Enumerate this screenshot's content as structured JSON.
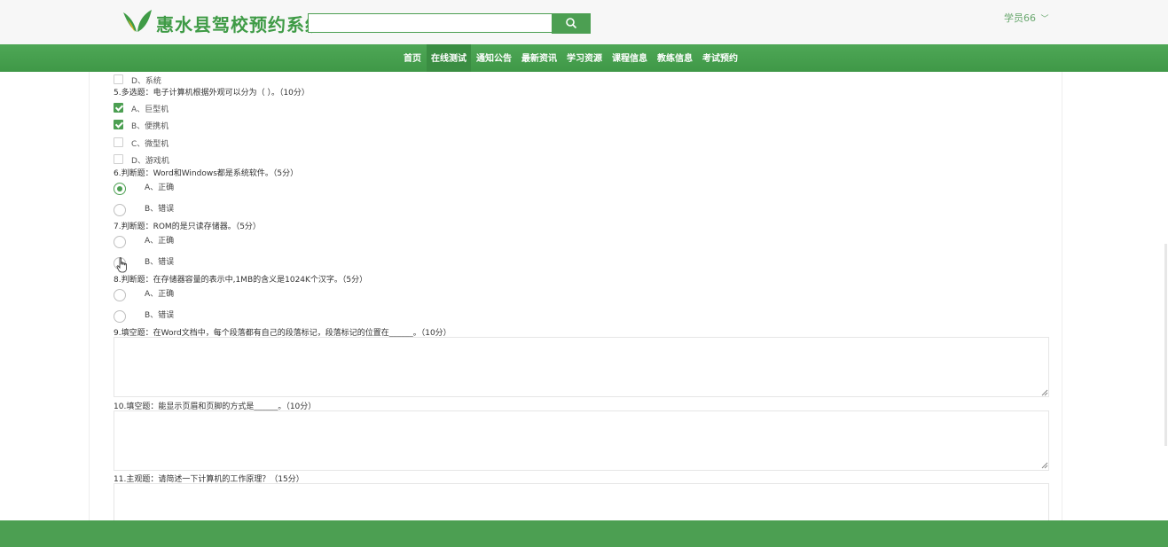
{
  "header": {
    "title": "惠水县驾校预约系统",
    "search_placeholder": "",
    "search_icon": "search-icon",
    "user_label": "学员66",
    "user_chevron": "﹀",
    "brand_color": "#3f9b46"
  },
  "nav": {
    "items": [
      {
        "label": "首页"
      },
      {
        "label": "在线测试"
      },
      {
        "label": "通知公告"
      },
      {
        "label": "最新资讯"
      },
      {
        "label": "学习资源"
      },
      {
        "label": "课程信息"
      },
      {
        "label": "教练信息"
      },
      {
        "label": "考试预约"
      }
    ]
  },
  "questions": {
    "q4": {
      "options": [
        {
          "label": "D、系统",
          "checked": false
        }
      ]
    },
    "q5": {
      "title": "5.多选题：电子计算机根据外观可以分为（      ）。（10分）",
      "options": [
        {
          "label": "A、巨型机",
          "checked": true
        },
        {
          "label": "B、便携机",
          "checked": true
        },
        {
          "label": "C、微型机",
          "checked": false
        },
        {
          "label": "D、游戏机",
          "checked": false
        }
      ]
    },
    "q6": {
      "title": "6.判断题：Word和Windows都是系统软件。（5分）",
      "options": [
        {
          "label": "A、正确",
          "selected": true
        },
        {
          "label": "B、错误",
          "selected": false
        }
      ]
    },
    "q7": {
      "title": "7.判断题：ROM的是只读存储器。（5分）",
      "options": [
        {
          "label": "A、正确",
          "selected": false
        },
        {
          "label": "B、错误",
          "selected": false
        }
      ]
    },
    "q8": {
      "title": "8.判断题：在存储器容量的表示中,1MB的含义是1024K个汉字。（5分）",
      "options": [
        {
          "label": "A、正确",
          "selected": false
        },
        {
          "label": "B、错误",
          "selected": false
        }
      ]
    },
    "q9": {
      "title": "9.填空题：在Word文档中，每个段落都有自己的段落标记，段落标记的位置在______。（10分）",
      "answer": ""
    },
    "q10": {
      "title": "10.填空题：能显示页眉和页脚的方式是______。（10分）",
      "answer": ""
    },
    "q11": {
      "title": "11.主观题：请简述一下计算机的工作原理？（15分）",
      "answer": ""
    }
  }
}
